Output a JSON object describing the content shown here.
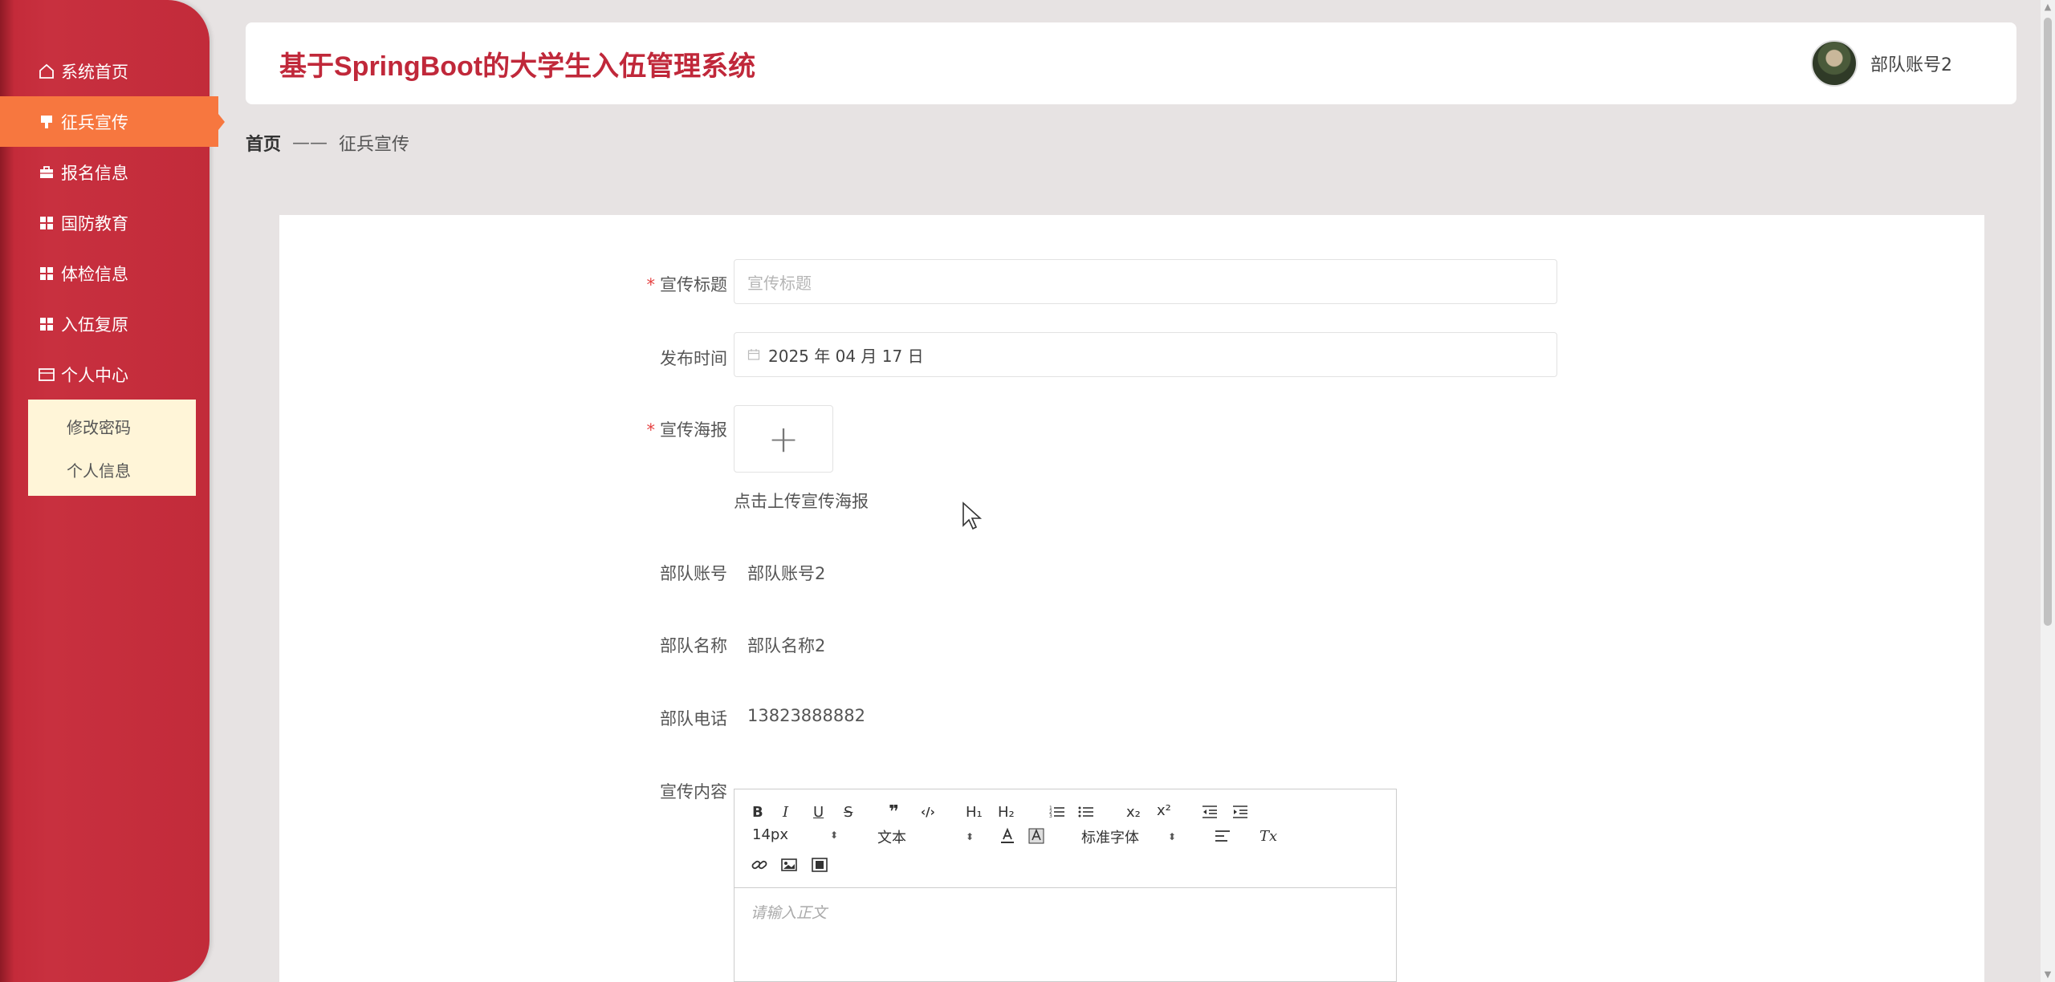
{
  "sidebar": {
    "items": [
      {
        "label": "系统首页",
        "icon": "home-icon"
      },
      {
        "label": "征兵宣传",
        "icon": "flag-icon",
        "active": true
      },
      {
        "label": "报名信息",
        "icon": "briefcase-icon"
      },
      {
        "label": "国防教育",
        "icon": "grid-icon"
      },
      {
        "label": "体检信息",
        "icon": "grid-icon"
      },
      {
        "label": "入伍复原",
        "icon": "grid-icon"
      },
      {
        "label": "个人中心",
        "icon": "wallet-icon"
      }
    ],
    "submenu": [
      {
        "label": "修改密码"
      },
      {
        "label": "个人信息"
      }
    ]
  },
  "header": {
    "title": "基于SpringBoot的大学生入伍管理系统",
    "user_name": "部队账号2"
  },
  "breadcrumb": {
    "home": "首页",
    "separator": "——",
    "current": "征兵宣传"
  },
  "form": {
    "title_label": "宣传标题",
    "title_placeholder": "宣传标题",
    "date_label": "发布时间",
    "date_value": "2025 年 04 月 17 日",
    "poster_label": "宣传海报",
    "upload_plus": "+",
    "upload_tip": "点击上传宣传海报",
    "account_label": "部队账号",
    "account_value": "部队账号2",
    "unit_name_label": "部队名称",
    "unit_name_value": "部队名称2",
    "phone_label": "部队电话",
    "phone_value": "13823888882",
    "content_label": "宣传内容",
    "required_mark": "*"
  },
  "editor": {
    "font_size": "14px",
    "block_type": "文本",
    "font_family": "标准字体",
    "placeholder": "请输入正文",
    "buttons": {
      "bold": "B",
      "italic": "I",
      "underline": "U",
      "strike": "S",
      "quote": "❞",
      "code": "‹/›",
      "h1": "H₁",
      "h2": "H₂",
      "sub": "x₂",
      "sup": "x²",
      "clean": "Tx"
    }
  },
  "colors": {
    "sidebar": "#c42b3a",
    "active_menu": "#f7773f",
    "title": "#c0283a",
    "submenu_bg": "#fff5d8",
    "page_bg": "#e7e3e3"
  }
}
